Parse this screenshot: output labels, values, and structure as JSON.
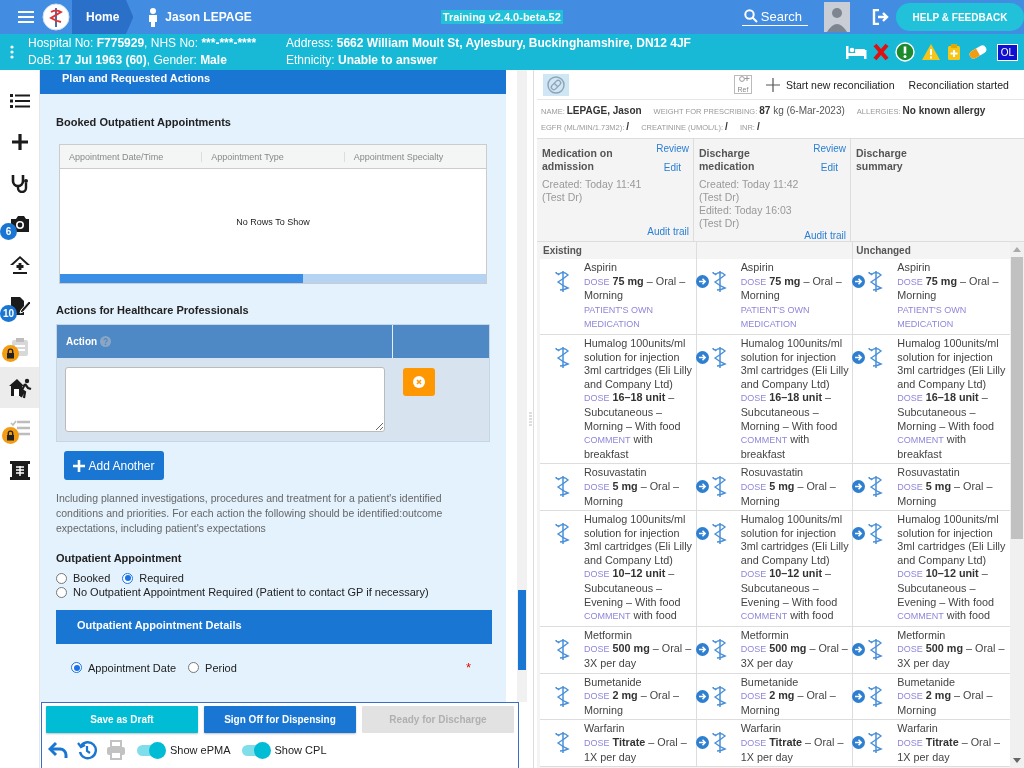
{
  "topbar": {
    "home": "Home",
    "patient": "Jason LEPAGE",
    "title": "Training v2.4.0-beta.52",
    "search": "Search",
    "help": "HELP & FEEDBACK"
  },
  "patient_bar": {
    "lines": [
      [
        {
          "label": "Hospital No: ",
          "value": "F775929"
        },
        {
          "label": ", NHS No: ",
          "value": "***-***-****"
        }
      ],
      [
        {
          "label": "DoB: ",
          "value": "17 Jul 1963 (60)"
        },
        {
          "label": ", Gender: ",
          "value": "Male"
        }
      ],
      [
        {
          "label": "Address: ",
          "value": "5662 William Moult St, Aylesbury, Buckinghamshire, DN12 4JF"
        }
      ],
      [
        {
          "label": "Ethnicity: ",
          "value": "Unable to answer"
        }
      ]
    ],
    "badge": "OL"
  },
  "sidebar": {
    "items": [
      {
        "selected": false,
        "locked": false
      },
      {
        "selected": false,
        "locked": false
      },
      {
        "selected": false,
        "locked": false
      },
      {
        "selected": false,
        "locked": false,
        "badge": "6"
      },
      {
        "selected": false,
        "locked": false
      },
      {
        "selected": false,
        "locked": false,
        "badge": "10"
      },
      {
        "selected": false,
        "locked": true
      },
      {
        "selected": true,
        "locked": false
      },
      {
        "selected": false,
        "locked": true
      },
      {
        "selected": false,
        "locked": false
      }
    ]
  },
  "form": {
    "section_title": "Plan and Requested Actions",
    "booked_label": "Booked Outpatient Appointments",
    "booked_grid": {
      "columns": [
        "Appointment Date/Time",
        "Appointment Type",
        "Appointment Specialty"
      ],
      "empty": "No Rows To Show"
    },
    "actions_label": "Actions for Healthcare Professionals",
    "actions_table": {
      "column": "Action"
    },
    "add_button": "Add Another",
    "help_text": "Including planned investigations, procedures and treatment for a patient's identified conditions and priorities. For each action the following should be identified:outcome expectations, including patient's expectations",
    "outpatient_label": "Outpatient Appointment",
    "outpatient_options": [
      {
        "label": "Booked",
        "selected": false
      },
      {
        "label": "Required",
        "selected": true
      },
      {
        "label": "No Outpatient Appointment Required (Patient to contact GP if necessary)",
        "selected": false
      }
    ],
    "details_title": "Outpatient Appointment Details",
    "details_options": [
      {
        "label": "Appointment Date",
        "selected": true
      },
      {
        "label": "Period",
        "selected": false
      }
    ],
    "required_mark": "*"
  },
  "footer": {
    "buttons": [
      {
        "label": "Save as Draft",
        "kind": "draft",
        "disabled": false
      },
      {
        "label": "Sign Off for Dispensing",
        "kind": "primary",
        "disabled": false
      },
      {
        "label": "Ready for Discharge",
        "kind": "primary",
        "disabled": true
      }
    ],
    "tools": [
      {
        "disabled": false
      },
      {
        "disabled": false
      },
      {
        "disabled": true
      }
    ],
    "toggles": [
      {
        "label": "Show ePMA",
        "on": true
      },
      {
        "label": "Show CPL",
        "on": true
      }
    ]
  },
  "reconciliation": {
    "ref_icon_text": "Ref",
    "start": "Start new reconciliation",
    "status": "Reconciliation started",
    "info": [
      [
        {
          "label": "NAME:",
          "value": "**LEPAGE, Jason**"
        },
        {
          "label": "WEIGHT FOR PRESCRIBING:",
          "value": "**87** kg (6-Mar-2023)"
        },
        {
          "label": "ALLERGIES:",
          "value": "**No known allergy**"
        }
      ],
      [
        {
          "label": "EGFR (ML/MIN/1.73M2):",
          "value": "**/**"
        },
        {
          "label": "CREATININE (UMOL/L):",
          "value": "**/**"
        },
        {
          "label": "INR:",
          "value": "**/**"
        }
      ]
    ],
    "columns": [
      {
        "title": "Medication on admission",
        "review": "Review",
        "edit": "Edit",
        "meta": [
          "Created: Today 11:41 (Test Dr)"
        ],
        "audit": "Audit trail",
        "group": "Existing"
      },
      {
        "title": "Discharge medication",
        "review": "Review",
        "edit": "Edit",
        "meta": [
          "Created: Today 11:42 (Test Dr)",
          "Edited: Today 16:03 (Test Dr)"
        ],
        "audit": "Audit trail"
      },
      {
        "title": "Discharge summary",
        "group": "Unchanged"
      }
    ],
    "rows": [
      {
        "cells": [
          {
            "arrow": false,
            "name": "Aspirin",
            "dose_label": "DOSE",
            "dose": "**75 mg** – Oral – Morning",
            "notes": [
              {
                "label": "PATIENT'S OWN MEDICATION"
              }
            ]
          },
          {
            "arrow": true,
            "name": "Aspirin",
            "dose_label": "DOSE",
            "dose": "**75 mg** – Oral – Morning",
            "notes": [
              {
                "label": "PATIENT'S OWN MEDICATION"
              }
            ]
          },
          {
            "arrow": true,
            "name": "Aspirin",
            "dose_label": "DOSE",
            "dose": "**75 mg** – Oral – Morning",
            "notes": [
              {
                "label": "PATIENT'S OWN MEDICATION"
              }
            ]
          }
        ]
      },
      {
        "cells": [
          {
            "arrow": false,
            "name": "Humalog 100units/ml solution for injection 3ml cartridges (Eli Lilly and Company Ltd)",
            "dose_label": "DOSE",
            "dose": "**16–18 unit** – Subcutaneous – Morning – With food",
            "notes": [
              {
                "label": "COMMENT",
                "text": "with breakfast"
              }
            ]
          },
          {
            "arrow": true,
            "name": "Humalog 100units/ml solution for injection 3ml cartridges (Eli Lilly and Company Ltd)",
            "dose_label": "DOSE",
            "dose": "**16–18 unit** – Subcutaneous – Morning – With food",
            "notes": [
              {
                "label": "COMMENT",
                "text": "with breakfast"
              }
            ]
          },
          {
            "arrow": true,
            "name": "Humalog 100units/ml solution for injection 3ml cartridges (Eli Lilly and Company Ltd)",
            "dose_label": "DOSE",
            "dose": "**16–18 unit** – Subcutaneous – Morning – With food",
            "notes": [
              {
                "label": "COMMENT",
                "text": "with breakfast"
              }
            ]
          }
        ]
      },
      {
        "cells": [
          {
            "arrow": false,
            "name": "Rosuvastatin",
            "dose_label": "DOSE",
            "dose": "**5 mg** – Oral – Morning"
          },
          {
            "arrow": true,
            "name": "Rosuvastatin",
            "dose_label": "DOSE",
            "dose": "**5 mg** – Oral – Morning"
          },
          {
            "arrow": true,
            "name": "Rosuvastatin",
            "dose_label": "DOSE",
            "dose": "**5 mg** – Oral – Morning"
          }
        ]
      },
      {
        "cells": [
          {
            "arrow": false,
            "name": "Humalog 100units/ml solution for injection 3ml cartridges (Eli Lilly and Company Ltd)",
            "dose_label": "DOSE",
            "dose": "**10–12 unit** – Subcutaneous – Evening – With food",
            "notes": [
              {
                "label": "COMMENT",
                "text": "with food"
              }
            ]
          },
          {
            "arrow": true,
            "name": "Humalog 100units/ml solution for injection 3ml cartridges (Eli Lilly and Company Ltd)",
            "dose_label": "DOSE",
            "dose": "**10–12 unit** – Subcutaneous – Evening – With food",
            "notes": [
              {
                "label": "COMMENT",
                "text": "with food"
              }
            ]
          },
          {
            "arrow": true,
            "name": "Humalog 100units/ml solution for injection 3ml cartridges (Eli Lilly and Company Ltd)",
            "dose_label": "DOSE",
            "dose": "**10–12 unit** – Subcutaneous – Evening – With food",
            "notes": [
              {
                "label": "COMMENT",
                "text": "with food"
              }
            ]
          }
        ]
      },
      {
        "cells": [
          {
            "arrow": false,
            "name": "Metformin",
            "dose_label": "DOSE",
            "dose": "**500 mg** – Oral – 3X per day"
          },
          {
            "arrow": true,
            "name": "Metformin",
            "dose_label": "DOSE",
            "dose": "**500 mg** – Oral – 3X per day"
          },
          {
            "arrow": true,
            "name": "Metformin",
            "dose_label": "DOSE",
            "dose": "**500 mg** – Oral – 3X per day"
          }
        ]
      },
      {
        "cells": [
          {
            "arrow": false,
            "name": "Bumetanide",
            "dose_label": "DOSE",
            "dose": "**2 mg** – Oral – Morning"
          },
          {
            "arrow": true,
            "name": "Bumetanide",
            "dose_label": "DOSE",
            "dose": "**2 mg** – Oral – Morning"
          },
          {
            "arrow": true,
            "name": "Bumetanide",
            "dose_label": "DOSE",
            "dose": "**2 mg** – Oral – Morning"
          }
        ]
      },
      {
        "cells": [
          {
            "arrow": false,
            "name": "Warfarin",
            "dose_label": "DOSE",
            "dose": "**Titrate** – Oral – 1X per day"
          },
          {
            "arrow": true,
            "name": "Warfarin",
            "dose_label": "DOSE",
            "dose": "**Titrate** – Oral – 1X per day"
          },
          {
            "arrow": true,
            "name": "Warfarin",
            "dose_label": "DOSE",
            "dose": "**Titrate** – Oral – 1X per day"
          }
        ]
      }
    ]
  }
}
